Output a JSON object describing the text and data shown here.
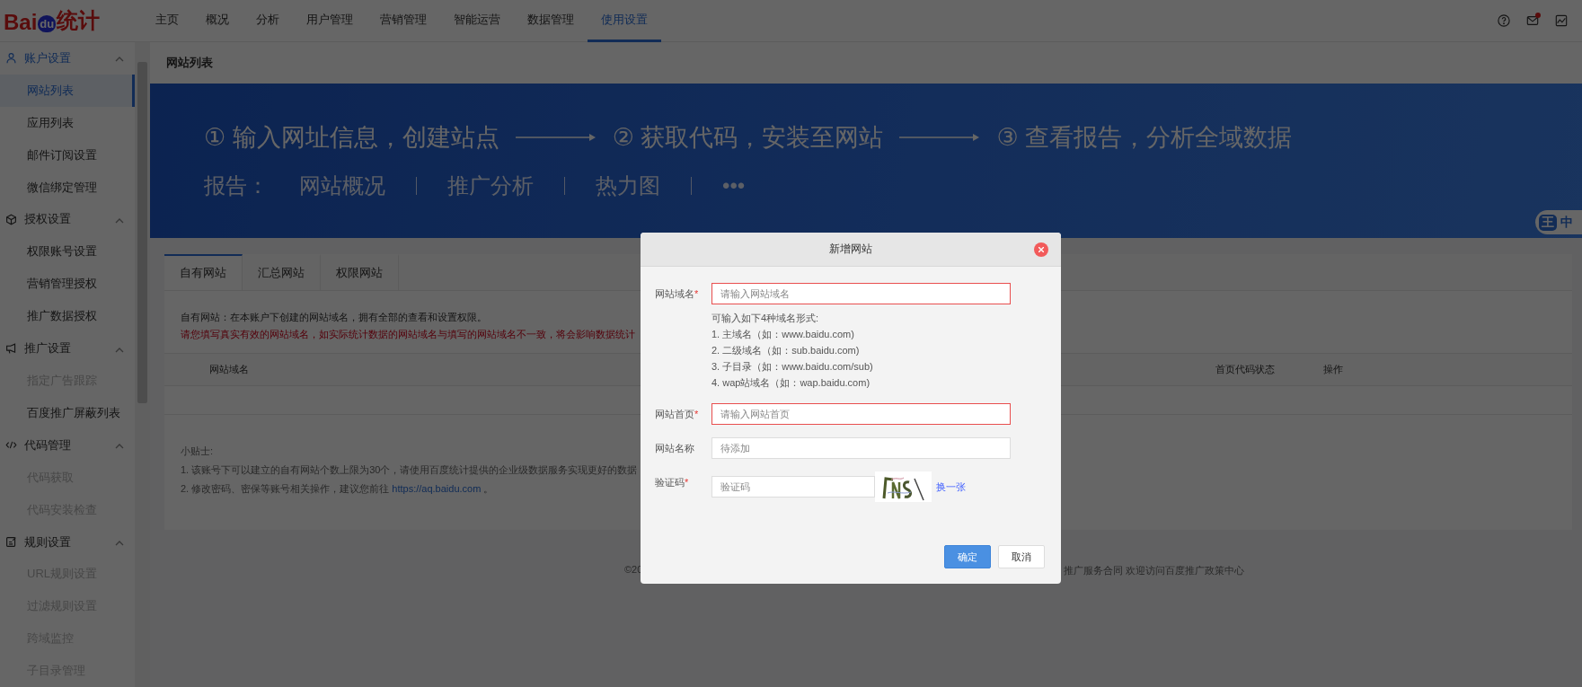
{
  "logo": {
    "brand": "Bai",
    "paw": "du",
    "product": "统计"
  },
  "nav": [
    {
      "label": "主页",
      "selected": false
    },
    {
      "label": "概况",
      "selected": false
    },
    {
      "label": "分析",
      "selected": false
    },
    {
      "label": "用户管理",
      "selected": false
    },
    {
      "label": "营销管理",
      "selected": false
    },
    {
      "label": "智能运营",
      "selected": false
    },
    {
      "label": "数据管理",
      "selected": false
    },
    {
      "label": "使用设置",
      "selected": true
    }
  ],
  "header_icons": [
    {
      "kind": "help",
      "badge": false
    },
    {
      "kind": "mail",
      "badge": true
    },
    {
      "kind": "chart",
      "badge": false
    }
  ],
  "sidebar": [
    {
      "label": "账户设置",
      "kind": "user",
      "selected": true,
      "expanded": true,
      "children": [
        {
          "label": "网站列表",
          "selected": true,
          "disabled": false
        },
        {
          "label": "应用列表",
          "selected": false,
          "disabled": false
        },
        {
          "label": "邮件订阅设置",
          "selected": false,
          "disabled": false
        },
        {
          "label": "微信绑定管理",
          "selected": false,
          "disabled": false
        }
      ]
    },
    {
      "label": "授权设置",
      "kind": "cube",
      "selected": false,
      "expanded": true,
      "children": [
        {
          "label": "权限账号设置",
          "selected": false,
          "disabled": false
        },
        {
          "label": "营销管理授权",
          "selected": false,
          "disabled": false
        },
        {
          "label": "推广数据授权",
          "selected": false,
          "disabled": false
        }
      ]
    },
    {
      "label": "推广设置",
      "kind": "megaphone",
      "selected": false,
      "expanded": true,
      "children": [
        {
          "label": "指定广告跟踪",
          "selected": false,
          "disabled": true
        },
        {
          "label": "百度推广屏蔽列表",
          "selected": false,
          "disabled": false
        }
      ]
    },
    {
      "label": "代码管理",
      "kind": "code",
      "selected": false,
      "expanded": true,
      "children": [
        {
          "label": "代码获取",
          "selected": false,
          "disabled": true
        },
        {
          "label": "代码安装检查",
          "selected": false,
          "disabled": true
        }
      ]
    },
    {
      "label": "规则设置",
      "kind": "edit",
      "selected": false,
      "expanded": true,
      "children": [
        {
          "label": "URL规则设置",
          "selected": false,
          "disabled": true
        },
        {
          "label": "过滤规则设置",
          "selected": false,
          "disabled": true
        },
        {
          "label": "跨域监控",
          "selected": false,
          "disabled": true
        },
        {
          "label": "子目录管理",
          "selected": false,
          "disabled": true
        }
      ]
    }
  ],
  "page_title": "网站列表",
  "banner": {
    "steps": [
      {
        "number": "①",
        "text": "输入网址信息，创建站点"
      },
      {
        "number": "②",
        "text": "获取代码，安装至网站"
      },
      {
        "number": "③",
        "text": "查看报告，分析全域数据"
      }
    ],
    "report_label": "报告：",
    "report_items": [
      "网站概况",
      "推广分析",
      "热力图",
      "•••"
    ],
    "ime": {
      "logo": "王",
      "mode": "中"
    }
  },
  "tabs": [
    {
      "label": "自有网站",
      "selected": true
    },
    {
      "label": "汇总网站",
      "selected": false
    },
    {
      "label": "权限网站",
      "selected": false
    }
  ],
  "intro": "自有网站：在本账户下创建的网站域名，拥有全部的查看和设置权限。",
  "warning": "请您填写真实有效的网站域名，如实际统计数据的网站域名与填写的网站域名不一致，将会影响数据统计",
  "table": {
    "columns": [
      "网站域名",
      "首页代码状态",
      "操作"
    ]
  },
  "tips": {
    "title": "小贴士:",
    "items": [
      {
        "text": "1. 该账号下可以建立的自有网站个数上限为30个，请使用百度统计提供的企业级数据服务实现更好的数据"
      },
      {
        "text": "2. 修改密码、密保等账号相关操作，建议您前往 ",
        "link": "https://aq.baidu.com",
        "suffix": " 。"
      }
    ]
  },
  "footer": [
    "©20",
    "推广服务合同 欢迎访问百度推广政策中心"
  ],
  "dialog": {
    "title": "新增网站",
    "fields": [
      {
        "kind": "text",
        "label": "网站域名",
        "required_mark": "*",
        "placeholder": "请输入网站域名",
        "error": true,
        "hint": [
          "可输入如下4种域名形式:",
          "1. 主域名（如：www.baidu.com)",
          "2. 二级域名（如：sub.baidu.com)",
          "3. 子目录（如：www.baidu.com/sub)",
          "4. wap站域名（如：wap.baidu.com)"
        ]
      },
      {
        "kind": "text",
        "label": "网站首页",
        "required_mark": "*",
        "placeholder": "请输入网站首页",
        "error": true
      },
      {
        "kind": "text",
        "label": "网站名称",
        "placeholder": "待添加",
        "error": false
      },
      {
        "kind": "captcha",
        "label": "验证码",
        "required_mark": "*",
        "placeholder": "验证码",
        "error": false,
        "refresh": "换一张"
      }
    ],
    "buttons": [
      {
        "label": "确定",
        "primary": true
      },
      {
        "label": "取消",
        "primary": false
      }
    ]
  }
}
